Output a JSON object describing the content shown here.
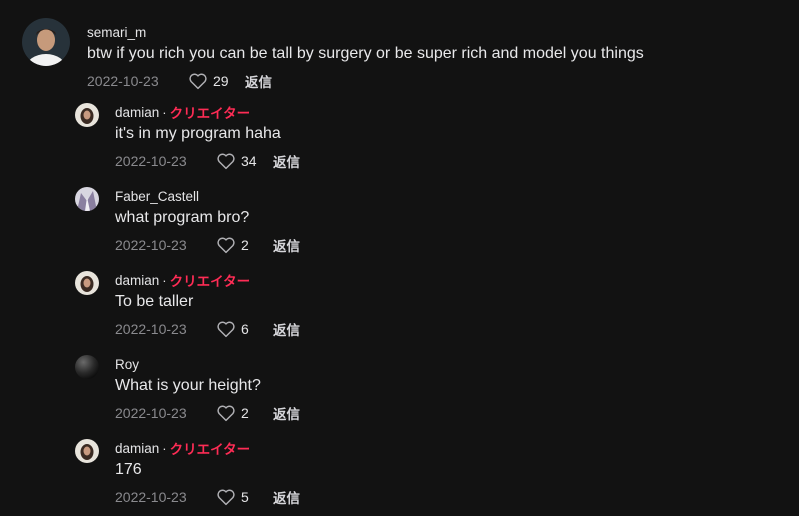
{
  "comments": [
    {
      "username": "semari_m",
      "creator": false,
      "text": "btw if you rich you can be tall by surgery or be super rich and model you things",
      "date": "2022-10-23",
      "likes": "29",
      "reply": "返信"
    },
    {
      "username": "damian",
      "creator": true,
      "creator_label": "クリエイター",
      "text": "it's in my program haha",
      "date": "2022-10-23",
      "likes": "34",
      "reply": "返信"
    },
    {
      "username": "Faber_Castell",
      "creator": false,
      "text": "what program bro?",
      "date": "2022-10-23",
      "likes": "2",
      "reply": "返信"
    },
    {
      "username": "damian",
      "creator": true,
      "creator_label": "クリエイター",
      "text": "To be taller",
      "date": "2022-10-23",
      "likes": "6",
      "reply": "返信"
    },
    {
      "username": "Roy",
      "creator": false,
      "text": "What is your height?",
      "date": "2022-10-23",
      "likes": "2",
      "reply": "返信"
    },
    {
      "username": "damian",
      "creator": true,
      "creator_label": "クリエイター",
      "text": "176",
      "date": "2022-10-23",
      "likes": "5",
      "reply": "返信"
    }
  ],
  "separator": "·",
  "icons": {
    "like": "heart-outline-icon"
  },
  "colors": {
    "background": "#121212",
    "creator_accent": "#fe2c55",
    "muted": "#8a8a8e"
  }
}
